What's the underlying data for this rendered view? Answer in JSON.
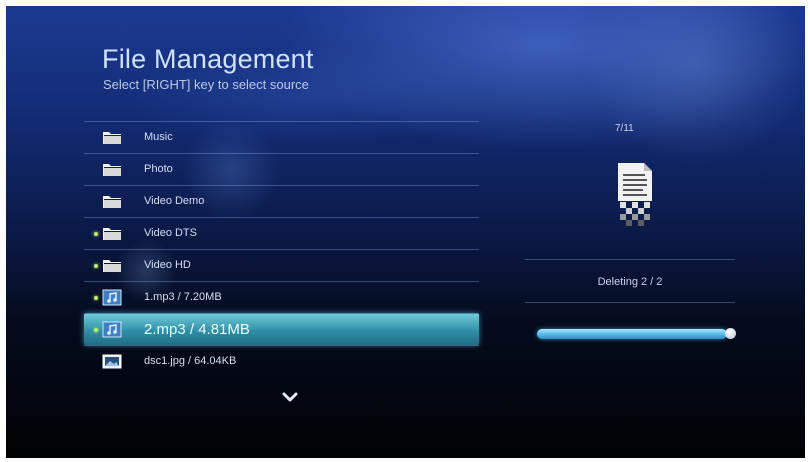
{
  "header": {
    "title": "File Management",
    "subtitle": "Select [RIGHT] key to select source"
  },
  "file_list": {
    "items": [
      {
        "label": "Music",
        "icon": "folder-icon",
        "marked": false,
        "selected": false
      },
      {
        "label": "Photo",
        "icon": "folder-icon",
        "marked": false,
        "selected": false
      },
      {
        "label": "Video Demo",
        "icon": "folder-icon",
        "marked": false,
        "selected": false
      },
      {
        "label": "Video DTS",
        "icon": "folder-icon",
        "marked": true,
        "selected": false
      },
      {
        "label": "Video HD",
        "icon": "folder-icon",
        "marked": true,
        "selected": false
      },
      {
        "label": "1.mp3 / 7.20MB",
        "icon": "music-file-icon",
        "marked": true,
        "selected": false
      },
      {
        "label": "2.mp3 / 4.81MB",
        "icon": "music-file-icon",
        "marked": true,
        "selected": true
      },
      {
        "label": "dsc1.jpg / 64.04KB",
        "icon": "image-file-icon",
        "marked": false,
        "selected": false
      }
    ],
    "more_indicator": "chevron-down-icon"
  },
  "details": {
    "counter": "7/11",
    "preview_icon": "document-shredding-icon",
    "status_text": "Deleting 2 / 2",
    "progress_percent": 100
  },
  "colors": {
    "accent": "#3fa8c8",
    "marker": "#b8f06a",
    "progress": "#4db4e4"
  }
}
